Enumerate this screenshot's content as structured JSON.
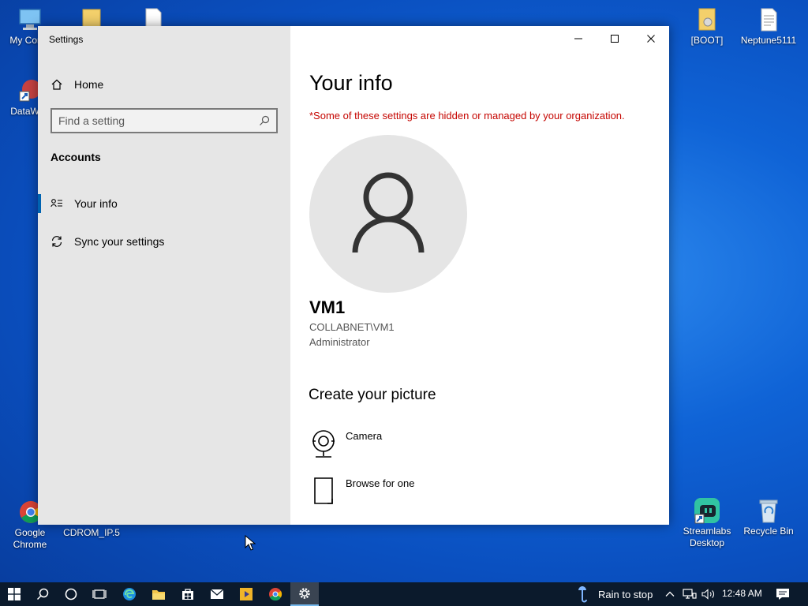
{
  "desktop": {
    "icons_left": [
      {
        "label": "My Comp",
        "icon": "computer-icon"
      },
      {
        "label": "DataWag",
        "icon": "app-shortcut-icon"
      },
      {
        "label": "Google Chrome",
        "icon": "chrome-icon"
      },
      {
        "label": "CDROM_IP.5",
        "icon": "file-icon"
      }
    ],
    "icons_right": [
      {
        "label": "[BOOT]",
        "icon": "folder-icon"
      },
      {
        "label": "Neptune5111",
        "icon": "document-icon"
      },
      {
        "label": "Streamlabs Desktop",
        "icon": "streamlabs-icon"
      },
      {
        "label": "Recycle Bin",
        "icon": "recycle-bin-icon"
      }
    ]
  },
  "window": {
    "title": "Settings",
    "nav": {
      "home": "Home",
      "search_placeholder": "Find a setting",
      "section": "Accounts",
      "items": [
        {
          "label": "Your info",
          "icon": "person-list-icon",
          "selected": true
        },
        {
          "label": "Sync your settings",
          "icon": "sync-icon",
          "selected": false
        }
      ]
    },
    "content": {
      "title": "Your info",
      "managed_note": "*Some of these settings are hidden or managed by your organization.",
      "user": {
        "name": "VM1",
        "domain": "COLLABNET\\VM1",
        "role": "Administrator"
      },
      "create_picture": {
        "title": "Create your picture",
        "options": [
          {
            "label": "Camera",
            "icon": "camera-icon"
          },
          {
            "label": "Browse for one",
            "icon": "browse-icon"
          }
        ]
      }
    }
  },
  "taskbar": {
    "weather": "Rain to stop",
    "time": "12:48 AM",
    "colors": {
      "background": "#0b1a2c",
      "accent": "#76b9ed"
    }
  },
  "colors": {
    "managed_note": "#c50500",
    "selection_accent": "#0063b1",
    "nav_background": "#e6e6e6"
  }
}
